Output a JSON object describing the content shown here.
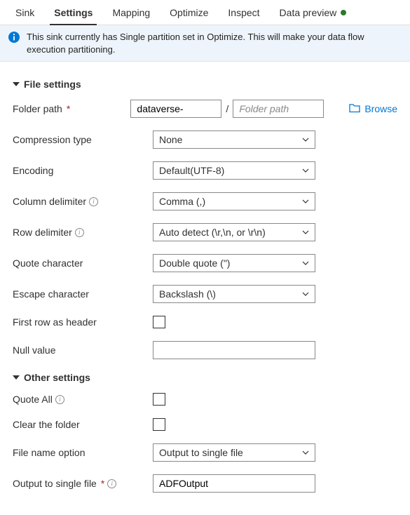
{
  "tabs": {
    "sink": "Sink",
    "settings": "Settings",
    "mapping": "Mapping",
    "optimize": "Optimize",
    "inspect": "Inspect",
    "preview": "Data preview"
  },
  "info": {
    "message": "This sink currently has Single partition set in Optimize. This will make your data flow execution partitioning."
  },
  "sections": {
    "file_settings": "File settings",
    "other_settings": "Other settings"
  },
  "labels": {
    "folder_path": "Folder path",
    "compression": "Compression type",
    "encoding": "Encoding",
    "column_delim": "Column delimiter",
    "row_delim": "Row delimiter",
    "quote_char": "Quote character",
    "escape_char": "Escape character",
    "first_row": "First row as header",
    "null_value": "Null value",
    "quote_all": "Quote All",
    "clear_folder": "Clear the folder",
    "file_name_option": "File name option",
    "output_single": "Output to single file"
  },
  "values": {
    "folder_container": "dataverse-",
    "folder_sub_placeholder": "Folder path",
    "browse": "Browse",
    "compression": "None",
    "encoding": "Default(UTF-8)",
    "column_delim": "Comma (,)",
    "row_delim": "Auto detect (\\r,\\n, or \\r\\n)",
    "quote_char": "Double quote (\")",
    "escape_char": "Backslash (\\)",
    "null_value": "",
    "file_name_option": "Output to single file",
    "output_single": "ADFOutput"
  }
}
